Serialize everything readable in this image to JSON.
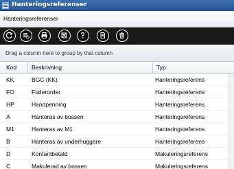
{
  "window": {
    "title": "Hanteringsreferenser"
  },
  "header": {
    "label": "Hanteringsreferenser"
  },
  "toolbar": {
    "buttons": [
      {
        "icon": "refresh-icon"
      },
      {
        "icon": "list-settings-icon"
      },
      {
        "icon": "print-icon"
      },
      {
        "icon": "export-icon"
      },
      {
        "icon": "help-icon"
      },
      {
        "icon": "document-icon"
      },
      {
        "icon": "trash-icon"
      }
    ]
  },
  "grid": {
    "group_hint": "Drag a column here to group by that column",
    "columns": [
      "Kod",
      "Beskrivning",
      "Typ"
    ],
    "rows": [
      {
        "kod": "KK",
        "beskrivning": "BGC (KK)",
        "typ": "Hanteringsreferens"
      },
      {
        "kod": "FO",
        "beskrivning": "Foderorder",
        "typ": "Hanteringsreferens"
      },
      {
        "kod": "HP",
        "beskrivning": "Handpenning",
        "typ": "Hanteringsreferens"
      },
      {
        "kod": "A",
        "beskrivning": "Hanteras av bossen",
        "typ": "Hanteringsreferens"
      },
      {
        "kod": "M1",
        "beskrivning": "Hanteras av M1",
        "typ": "Hanteringsreferens"
      },
      {
        "kod": "B",
        "beskrivning": "Hanteras av underhuggare",
        "typ": "Hanteringsreferens"
      },
      {
        "kod": "D",
        "beskrivning": "Kontantbetald",
        "typ": "Makuleringsreferens"
      },
      {
        "kod": "C",
        "beskrivning": "Makulerad av bossen",
        "typ": "Makuleringsreferens"
      }
    ]
  }
}
